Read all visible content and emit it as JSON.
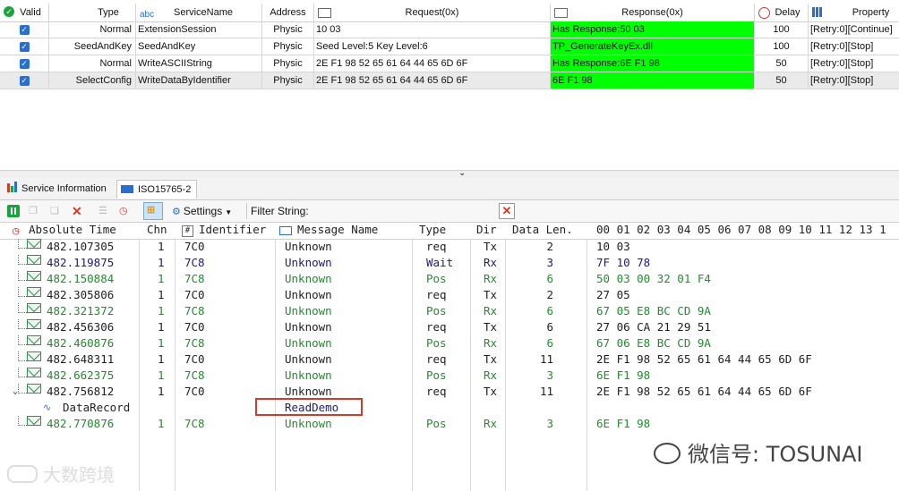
{
  "service_table": {
    "headers": {
      "valid": "Valid",
      "type": "Type",
      "service_name": "ServiceName",
      "service_name_prefix": "abc",
      "address": "Address",
      "request": "Request(0x)",
      "response": "Response(0x)",
      "delay": "Delay",
      "property": "Property"
    },
    "rows": [
      {
        "valid": true,
        "type": "Normal",
        "service_name": "ExtensionSession",
        "address": "Physic",
        "request": "10 03",
        "response": "Has Response:50 03",
        "delay": "100",
        "property": "[Retry:0][Continue]"
      },
      {
        "valid": true,
        "type": "SeedAndKey",
        "service_name": "SeedAndKey",
        "address": "Physic",
        "request": "Seed Level:5 Key Level:6",
        "response": "TP_GenerateKeyEx.dll",
        "delay": "100",
        "property": "[Retry:0][Stop]"
      },
      {
        "valid": true,
        "type": "Normal",
        "service_name": "WriteASCIIString",
        "address": "Physic",
        "request": "2E F1 98 52 65 61 64 44 65 6D 6F",
        "response": "Has Response:6E F1 98",
        "delay": "50",
        "property": "[Retry:0][Stop]"
      },
      {
        "valid": true,
        "type": "SelectConfig",
        "service_name": "WriteDataByIdentifier",
        "address": "Physic",
        "request": "2E F1 98 52 65 61 64 44 65 6D 6F",
        "response": "6E F1 98",
        "delay": "50",
        "property": "[Retry:0][Stop]"
      }
    ],
    "response_color": "#00ff00"
  },
  "tabs": [
    {
      "label": "Service Information",
      "active": false
    },
    {
      "label": "ISO15765-2",
      "active": true
    }
  ],
  "toolbar": {
    "settings_label": "Settings",
    "filter_label": "Filter String:",
    "filter_value": ""
  },
  "trace": {
    "headers": {
      "time": "Absolute Time",
      "chn": "Chn",
      "identifier": "Identifier",
      "message_name": "Message Name",
      "type": "Type",
      "dir": "Dir",
      "data_len": "Data Len.",
      "bytes": "00 01 02 03 04 05 06 07 08 09 10 11 12 13 1"
    },
    "rows": [
      {
        "time": "482.107305",
        "chn": "1",
        "id": "7C0",
        "name": "Unknown",
        "type": "req",
        "dir": "Tx",
        "len": "2",
        "data": "10 03",
        "color": "gray"
      },
      {
        "time": "482.119875",
        "chn": "1",
        "id": "7C8",
        "name": "Unknown",
        "type": "Wait",
        "dir": "Rx",
        "len": "3",
        "data": "7F 10 78",
        "color": "navy"
      },
      {
        "time": "482.150884",
        "chn": "1",
        "id": "7C8",
        "name": "Unknown",
        "type": "Pos",
        "dir": "Rx",
        "len": "6",
        "data": "50 03 00 32 01 F4",
        "color": "green"
      },
      {
        "time": "482.305806",
        "chn": "1",
        "id": "7C0",
        "name": "Unknown",
        "type": "req",
        "dir": "Tx",
        "len": "2",
        "data": "27 05",
        "color": "gray"
      },
      {
        "time": "482.321372",
        "chn": "1",
        "id": "7C8",
        "name": "Unknown",
        "type": "Pos",
        "dir": "Rx",
        "len": "6",
        "data": "67 05 E8 BC CD 9A",
        "color": "green"
      },
      {
        "time": "482.456306",
        "chn": "1",
        "id": "7C0",
        "name": "Unknown",
        "type": "req",
        "dir": "Tx",
        "len": "6",
        "data": "27 06 CA 21 29 51",
        "color": "gray"
      },
      {
        "time": "482.460876",
        "chn": "1",
        "id": "7C8",
        "name": "Unknown",
        "type": "Pos",
        "dir": "Rx",
        "len": "6",
        "data": "67 06 E8 BC CD 9A",
        "color": "green"
      },
      {
        "time": "482.648311",
        "chn": "1",
        "id": "7C0",
        "name": "Unknown",
        "type": "req",
        "dir": "Tx",
        "len": "11",
        "data": "2E F1 98 52 65 61 64 44 65 6D 6F",
        "color": "gray"
      },
      {
        "time": "482.662375",
        "chn": "1",
        "id": "7C8",
        "name": "Unknown",
        "type": "Pos",
        "dir": "Rx",
        "len": "3",
        "data": "6E F1 98",
        "color": "green"
      },
      {
        "time": "482.756812",
        "chn": "1",
        "id": "7C0",
        "name": "Unknown",
        "type": "req",
        "dir": "Tx",
        "len": "11",
        "data": "2E F1 98 52 65 61 64 44 65 6D 6F",
        "color": "gray",
        "expanded": true
      },
      {
        "time": "DataRecord",
        "chn": "",
        "id": "",
        "name": "ReadDemo",
        "type": "",
        "dir": "",
        "len": "",
        "data": "",
        "color": "gray",
        "child": true
      },
      {
        "time": "482.770876",
        "chn": "1",
        "id": "7C8",
        "name": "Unknown",
        "type": "Pos",
        "dir": "Rx",
        "len": "3",
        "data": "6E F1 98",
        "color": "green"
      }
    ]
  },
  "watermarks": {
    "right": "微信号: TOSUNAI",
    "left": "大数跨境"
  }
}
